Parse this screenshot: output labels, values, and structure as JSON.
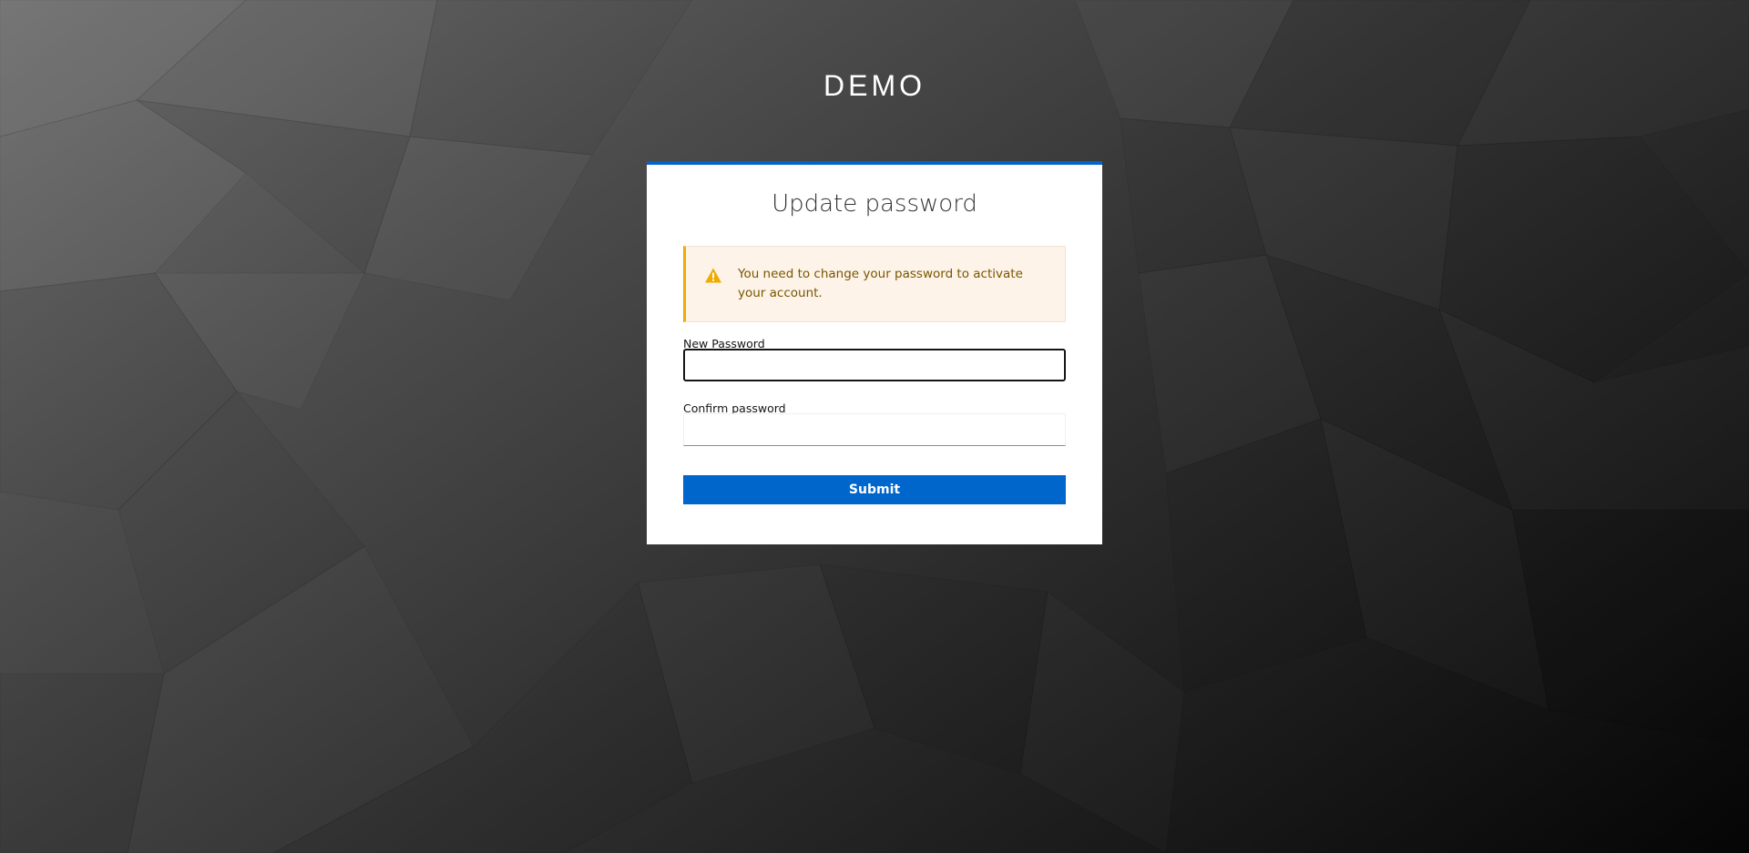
{
  "brand": {
    "title": "DEMO"
  },
  "card": {
    "title": "Update password",
    "accent_color": "#0066cc"
  },
  "alert": {
    "type": "warning",
    "icon": "warning-triangle-icon",
    "color": "#f0ab00",
    "message": "You need to change your password to activate your account."
  },
  "form": {
    "new_password": {
      "label": "New Password",
      "value": "",
      "focused": true
    },
    "confirm_password": {
      "label": "Confirm password",
      "value": ""
    },
    "submit_label": "Submit"
  }
}
